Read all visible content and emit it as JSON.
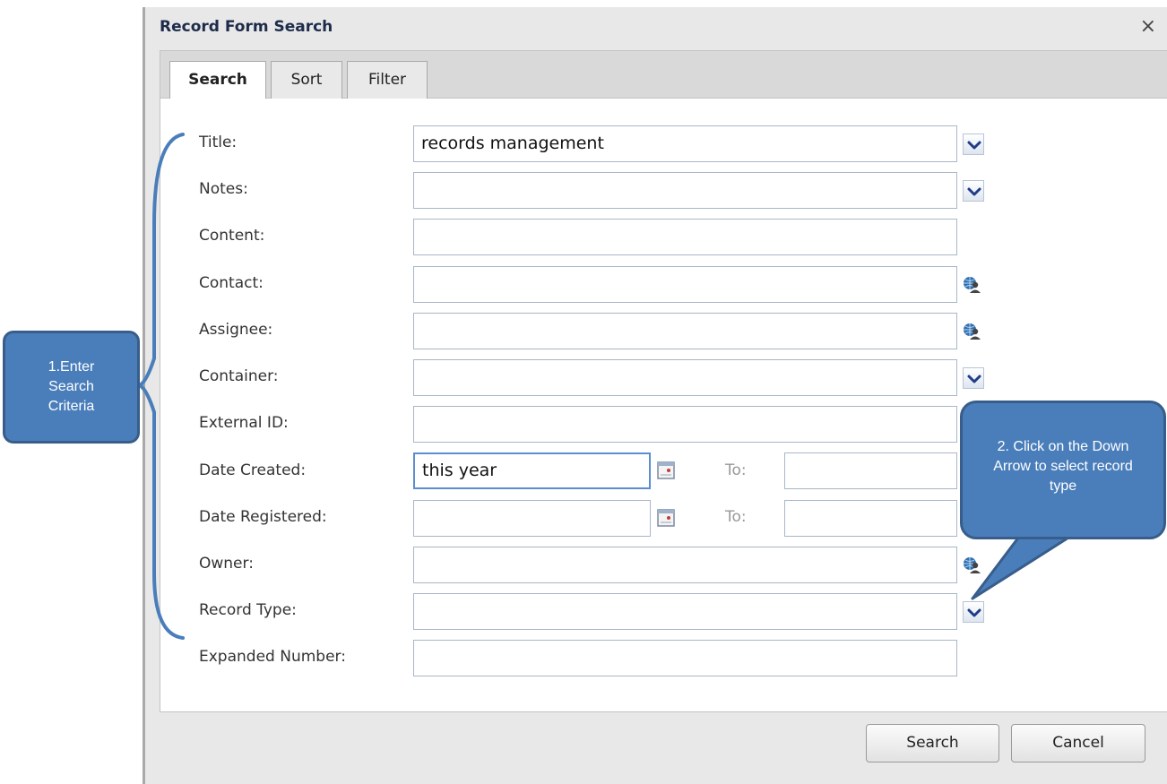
{
  "dialog": {
    "title": "Record Form Search",
    "close_glyph": "×"
  },
  "tabs": [
    {
      "label": "Search",
      "active": true
    },
    {
      "label": "Sort",
      "active": false
    },
    {
      "label": "Filter",
      "active": false
    }
  ],
  "fields": {
    "title": {
      "label": "Title:",
      "value": "records management",
      "trigger": "chevron-down-icon"
    },
    "notes": {
      "label": "Notes:",
      "value": "",
      "trigger": "chevron-down-icon"
    },
    "content": {
      "label": "Content:",
      "value": ""
    },
    "contact": {
      "label": "Contact:",
      "value": "",
      "trigger": "globe-person-icon"
    },
    "assignee": {
      "label": "Assignee:",
      "value": "",
      "trigger": "globe-person-icon"
    },
    "container": {
      "label": "Container:",
      "value": "",
      "trigger": "chevron-down-icon"
    },
    "external_id": {
      "label": "External ID:",
      "value": ""
    },
    "date_created": {
      "label": "Date Created:",
      "value": "this year",
      "to_label": "To:",
      "to_value": "",
      "trigger": "calendar-icon"
    },
    "date_registered": {
      "label": "Date Registered:",
      "value": "",
      "to_label": "To:",
      "to_value": "",
      "trigger": "calendar-icon"
    },
    "owner": {
      "label": "Owner:",
      "value": "",
      "trigger": "globe-person-icon"
    },
    "record_type": {
      "label": "Record Type:",
      "value": "",
      "trigger": "chevron-down-icon"
    },
    "expanded_number": {
      "label": "Expanded Number:",
      "value": ""
    }
  },
  "footer": {
    "search_label": "Search",
    "cancel_label": "Cancel"
  },
  "annotations": {
    "callout1": "1.Enter Search Criteria",
    "callout2": "2. Click on the Down Arrow to select record type"
  },
  "colors": {
    "callout_fill": "#4a7ebb",
    "callout_border": "#385d8a",
    "chevron": "#1f3c88"
  }
}
